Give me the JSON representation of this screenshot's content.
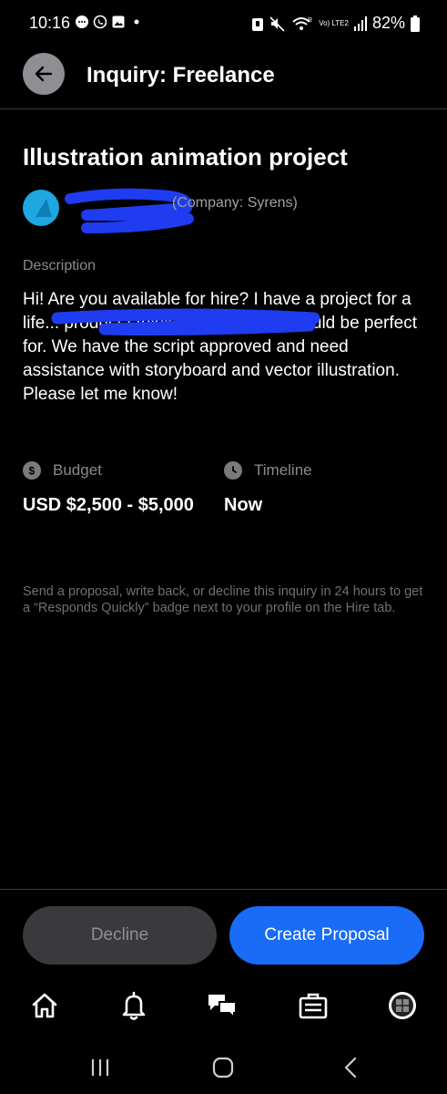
{
  "status_bar": {
    "time": "10:16",
    "battery": "82%",
    "network_small": "Vo) LTE2"
  },
  "header": {
    "title": "Inquiry: Freelance"
  },
  "project": {
    "title": "Illustration animation project",
    "company": "(Company: Syrens)"
  },
  "description": {
    "label": "Description",
    "text": "Hi! Are you available for hire? I have a project for a life... product I think your aesthetic would be perfect for. We have the script approved and need assistance with storyboard and vector illustration. Please let me know!"
  },
  "budget": {
    "label": "Budget",
    "value": "USD $2,500 - $5,000"
  },
  "timeline": {
    "label": "Timeline",
    "value": "Now"
  },
  "note": "Send a proposal, write back, or decline this inquiry in 24 hours to get a “Responds Quickly” badge next to your profile on the Hire tab.",
  "actions": {
    "decline": "Decline",
    "create": "Create Proposal"
  },
  "colors": {
    "background": "#000000",
    "accent": "#1a6bf5",
    "redaction": "#1f3cf0",
    "avatar": "#1ea7e0"
  },
  "nav_icons": [
    "home-icon",
    "bell-icon",
    "messages-icon",
    "briefcase-icon",
    "profile-icon"
  ]
}
